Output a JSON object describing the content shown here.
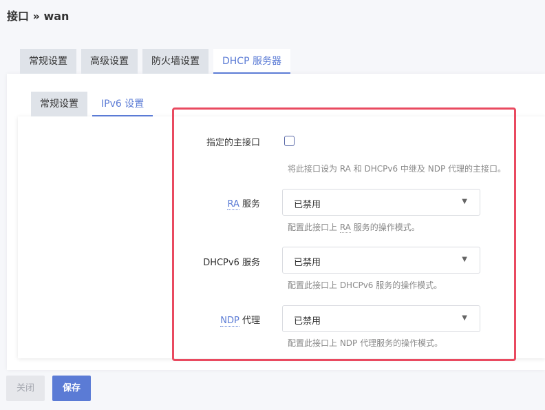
{
  "header": {
    "title": "接口 » wan"
  },
  "outer_tabs": [
    {
      "label": "常规设置",
      "active": false
    },
    {
      "label": "高级设置",
      "active": false
    },
    {
      "label": "防火墙设置",
      "active": false
    },
    {
      "label": "DHCP 服务器",
      "active": true
    }
  ],
  "inner_tabs": [
    {
      "label": "常规设置",
      "active": false
    },
    {
      "label": "IPv6 设置",
      "active": true
    }
  ],
  "form": {
    "master": {
      "label": "指定的主接口",
      "checked": false,
      "hint": "将此接口设为 RA 和 DHCPv6 中继及 NDP 代理的主接口。"
    },
    "ra": {
      "label_abbr": "RA",
      "label_rest": " 服务",
      "value": "已禁用",
      "hint_prefix": "配置此接口上 ",
      "hint_abbr": "RA",
      "hint_suffix": " 服务的操作模式。"
    },
    "dhcpv6": {
      "label": "DHCPv6 服务",
      "value": "已禁用",
      "hint": "配置此接口上 DHCPv6 服务的操作模式。"
    },
    "ndp": {
      "label_abbr": "NDP",
      "label_rest": " 代理",
      "value": "已禁用",
      "hint": "配置此接口上 NDP 代理服务的操作模式。"
    }
  },
  "icons": {
    "select_arrow": "▼"
  },
  "colors": {
    "accent": "#5b7bd5",
    "highlight": "#e94a60"
  },
  "footer": {
    "close_label": "关闭",
    "save_label": "保存"
  }
}
